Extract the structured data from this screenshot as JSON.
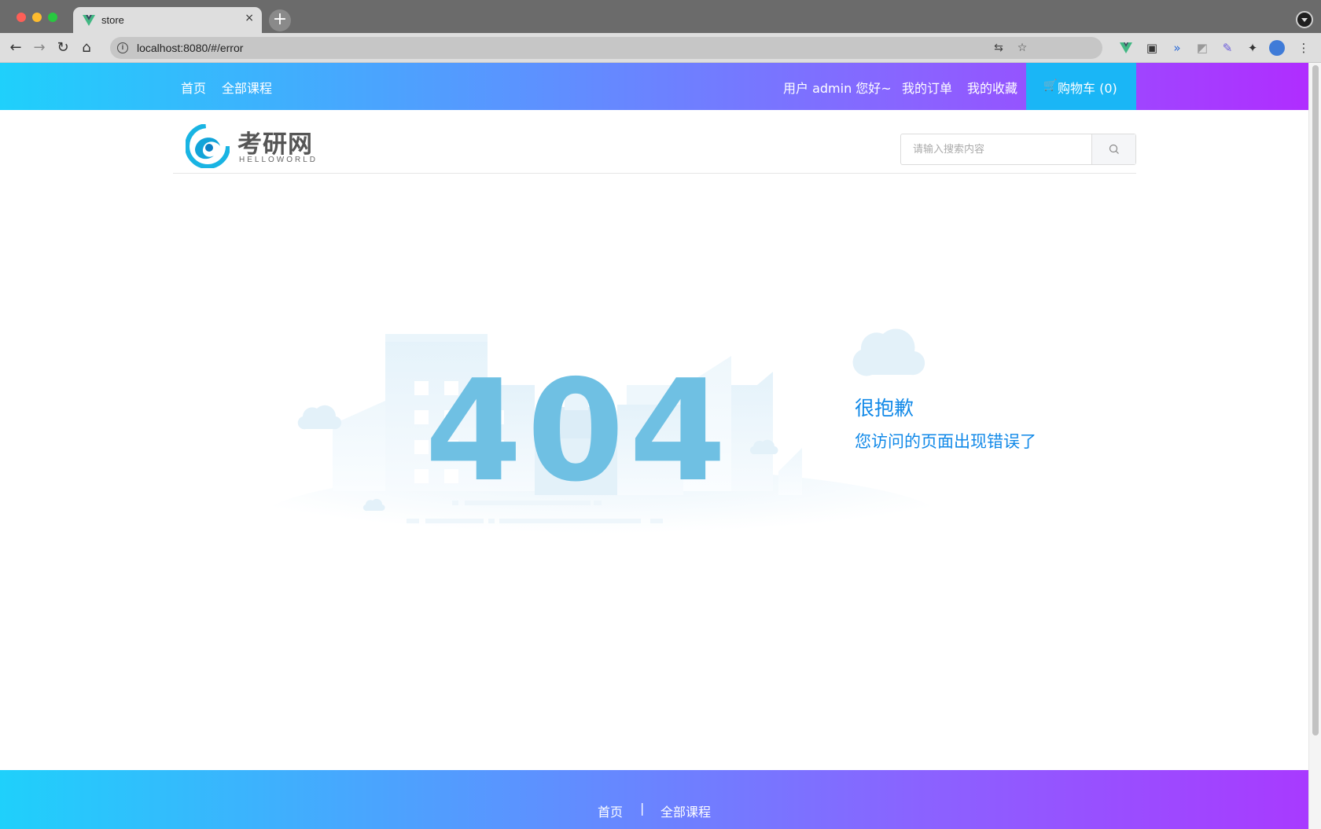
{
  "browser": {
    "tab_title": "store",
    "tab_close": "×",
    "new_tab": "+",
    "url": "localhost:8080/#/error"
  },
  "topnav": {
    "home": "首页",
    "all_courses": "全部课程",
    "user_greeting": "用户 admin 您好~",
    "my_orders": "我的订单",
    "my_favorites": "我的收藏",
    "cart": "购物车 (0)"
  },
  "header": {
    "logo_title": "考研网",
    "logo_subtitle": "HELLOWORLD",
    "search_placeholder": "请输入搜索内容"
  },
  "error": {
    "code": "404",
    "title": "很抱歉",
    "message": "您访问的页面出现错误了"
  },
  "footer": {
    "home": "首页",
    "separator": "|",
    "all_courses": "全部课程"
  },
  "colors": {
    "accent": "#1189e8",
    "nav_gradient_start": "#1fd0fb",
    "nav_gradient_end": "#b02dff",
    "cart_bg": "#1ab6f6",
    "error_code": "#6fc0e3"
  }
}
